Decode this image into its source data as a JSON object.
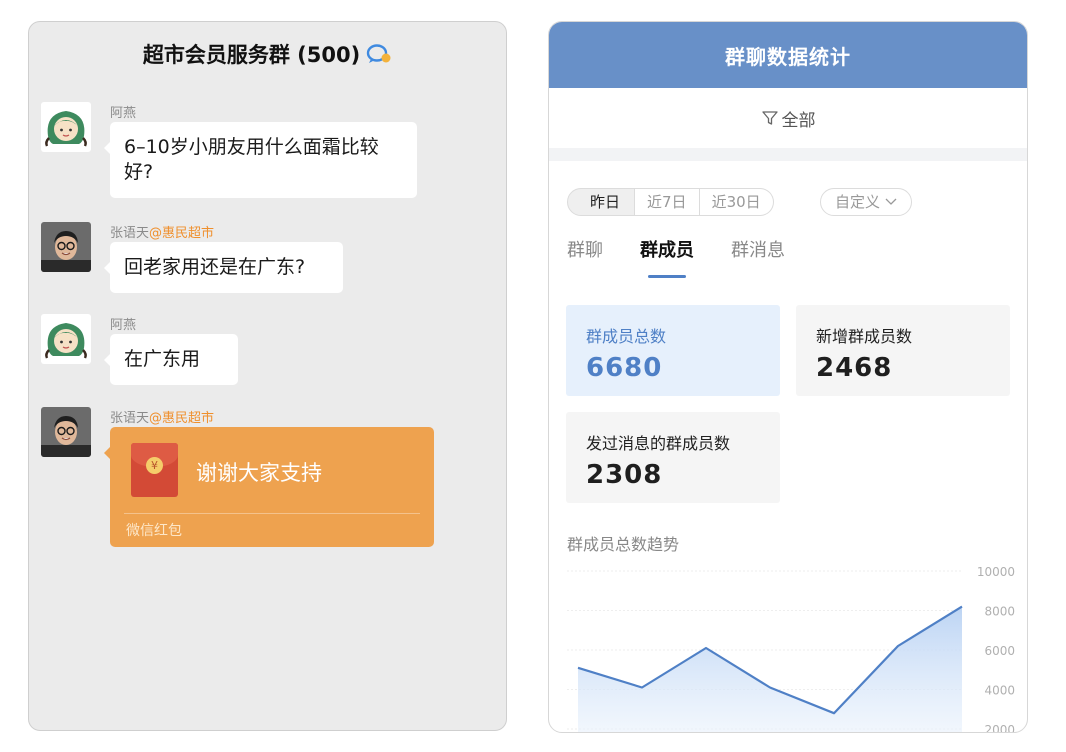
{
  "chat": {
    "title": "超市会员服务群 (500)",
    "group_icon": "group-chat-icon",
    "messages": [
      {
        "sender": "阿燕",
        "sender_tag": "",
        "text": "6–10岁小朋友用什么面霜比较好?"
      },
      {
        "sender": "张语天",
        "sender_tag": "@惠民超市",
        "text": "回老家用还是在广东?"
      },
      {
        "sender": "阿燕",
        "sender_tag": "",
        "text": "在广东用"
      },
      {
        "sender": "张语天",
        "sender_tag": "@惠民超市",
        "red_packet": {
          "text": "谢谢大家支持",
          "footer": "微信红包"
        }
      }
    ]
  },
  "stats": {
    "title": "群聊数据统计",
    "filter_label": "全部",
    "date_ranges": [
      "昨日",
      "近7日",
      "近30日"
    ],
    "selected_range": "昨日",
    "custom_label": "自定义",
    "tabs": [
      "群聊",
      "群成员",
      "群消息"
    ],
    "active_tab": "群成员",
    "cards": [
      {
        "label": "群成员总数",
        "value": "6680"
      },
      {
        "label": "新增群成员数",
        "value": "2468"
      },
      {
        "label": "发过消息的群成员数",
        "value": "2308"
      }
    ],
    "trend_title": "群成员总数趋势",
    "colors": {
      "header": "#6890c8",
      "accent": "#4f80c6",
      "orange": "#ef8f2c",
      "red_packet": "#eea24f"
    }
  },
  "chart_data": {
    "type": "area",
    "title": "",
    "xlabel": "",
    "ylabel": "",
    "y_ticks": [
      "10000",
      "8000",
      "6000",
      "4000",
      "2000"
    ],
    "ylim": [
      2000,
      10000
    ],
    "grid": true,
    "series": [
      {
        "values": [
          5100,
          4100,
          6100,
          4100,
          2800,
          6200,
          8200
        ]
      }
    ]
  }
}
